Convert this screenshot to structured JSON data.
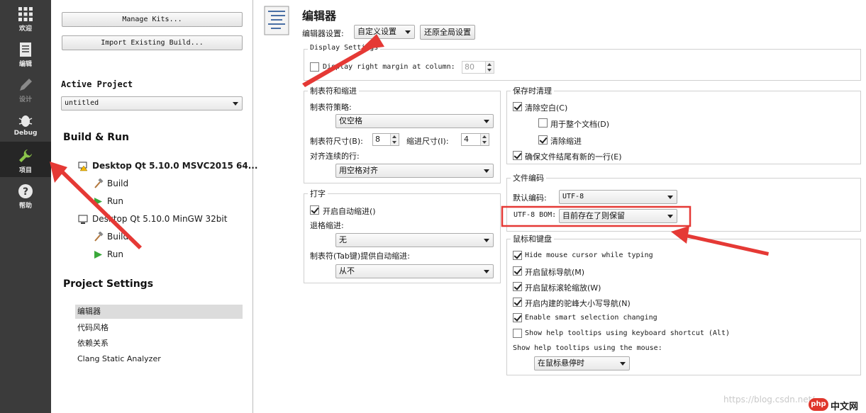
{
  "modebar": {
    "items": [
      {
        "label": "欢迎",
        "icon": "grid-icon"
      },
      {
        "label": "编辑",
        "icon": "document-icon"
      },
      {
        "label": "设计",
        "icon": "pencil-icon"
      },
      {
        "label": "Debug",
        "icon": "bug-icon"
      },
      {
        "label": "项目",
        "icon": "wrench-icon"
      },
      {
        "label": "帮助",
        "icon": "help-icon"
      }
    ]
  },
  "nav": {
    "manage_kits": "Manage Kits...",
    "import_build": "Import Existing Build...",
    "active_project_heading": "Active Project",
    "active_project_value": "untitled",
    "build_run_heading": "Build & Run",
    "kits": [
      {
        "name": "Desktop Qt 5.10.0 MSVC2015 64...",
        "build": "Build",
        "run": "Run"
      },
      {
        "name": "Desktop Qt 5.10.0 MinGW 32bit",
        "build": "Build",
        "run": "Run"
      }
    ],
    "project_settings_heading": "Project Settings",
    "settings_items": [
      "编辑器",
      "代码风格",
      "依赖关系",
      "Clang Static Analyzer"
    ]
  },
  "editor": {
    "title": "编辑器",
    "settings_label": "编辑器设置:",
    "settings_value": "自定义设置",
    "restore_button": "还原全局设置",
    "display_settings": {
      "title": "Display Settings",
      "margin_label": "Display right margin at column:",
      "margin_checked": false,
      "margin_value": "80"
    },
    "tabs": {
      "title": "制表符和缩进",
      "policy_label": "制表符策略:",
      "policy_value": "仅空格",
      "tab_size_label": "制表符尺寸(B):",
      "tab_size_value": "8",
      "indent_size_label": "缩进尺寸(I):",
      "indent_size_value": "4",
      "continuation_label": "对齐连续的行:",
      "continuation_value": "用空格对齐"
    },
    "typing": {
      "title": "打字",
      "auto_indent_label": "开启自动缩进()",
      "auto_indent_checked": true,
      "backspace_label": "退格缩进:",
      "backspace_value": "无",
      "tab_key_label": "制表符(Tab键)提供自动缩进:",
      "tab_key_value": "从不"
    },
    "cleanup": {
      "title": "保存时清理",
      "items": [
        {
          "label": "清除空白(C)",
          "checked": true
        },
        {
          "label": "用于整个文档(D)",
          "checked": false
        },
        {
          "label": "清除缩进",
          "checked": true
        },
        {
          "label": "确保文件结尾有新的一行(E)",
          "checked": true
        }
      ]
    },
    "encoding": {
      "title": "文件编码",
      "default_label": "默认编码:",
      "default_value": "UTF-8",
      "bom_label": "UTF-8 BOM:",
      "bom_value": "目前存在了则保留"
    },
    "mouse": {
      "title": "鼠标和键盘",
      "items": [
        {
          "label": "Hide mouse cursor while typing",
          "checked": true
        },
        {
          "label": "开启鼠标导航(M)",
          "checked": true
        },
        {
          "label": "开启鼠标滚轮缩放(W)",
          "checked": true
        },
        {
          "label": "开启内建的驼峰大小写导航(N)",
          "checked": true
        },
        {
          "label": "Enable smart selection changing",
          "checked": true
        },
        {
          "label": "Show help tooltips using keyboard shortcut (Alt)",
          "checked": false
        }
      ],
      "tooltips_label": "Show help tooltips using the mouse:",
      "tooltips_value": "在鼠标悬停时"
    }
  },
  "watermark": "https://blog.csdn.net/...",
  "logo": {
    "badge": "php",
    "text": "中文网"
  },
  "colors": {
    "modebar": "#3b3b3b",
    "annotation": "#e53935"
  }
}
